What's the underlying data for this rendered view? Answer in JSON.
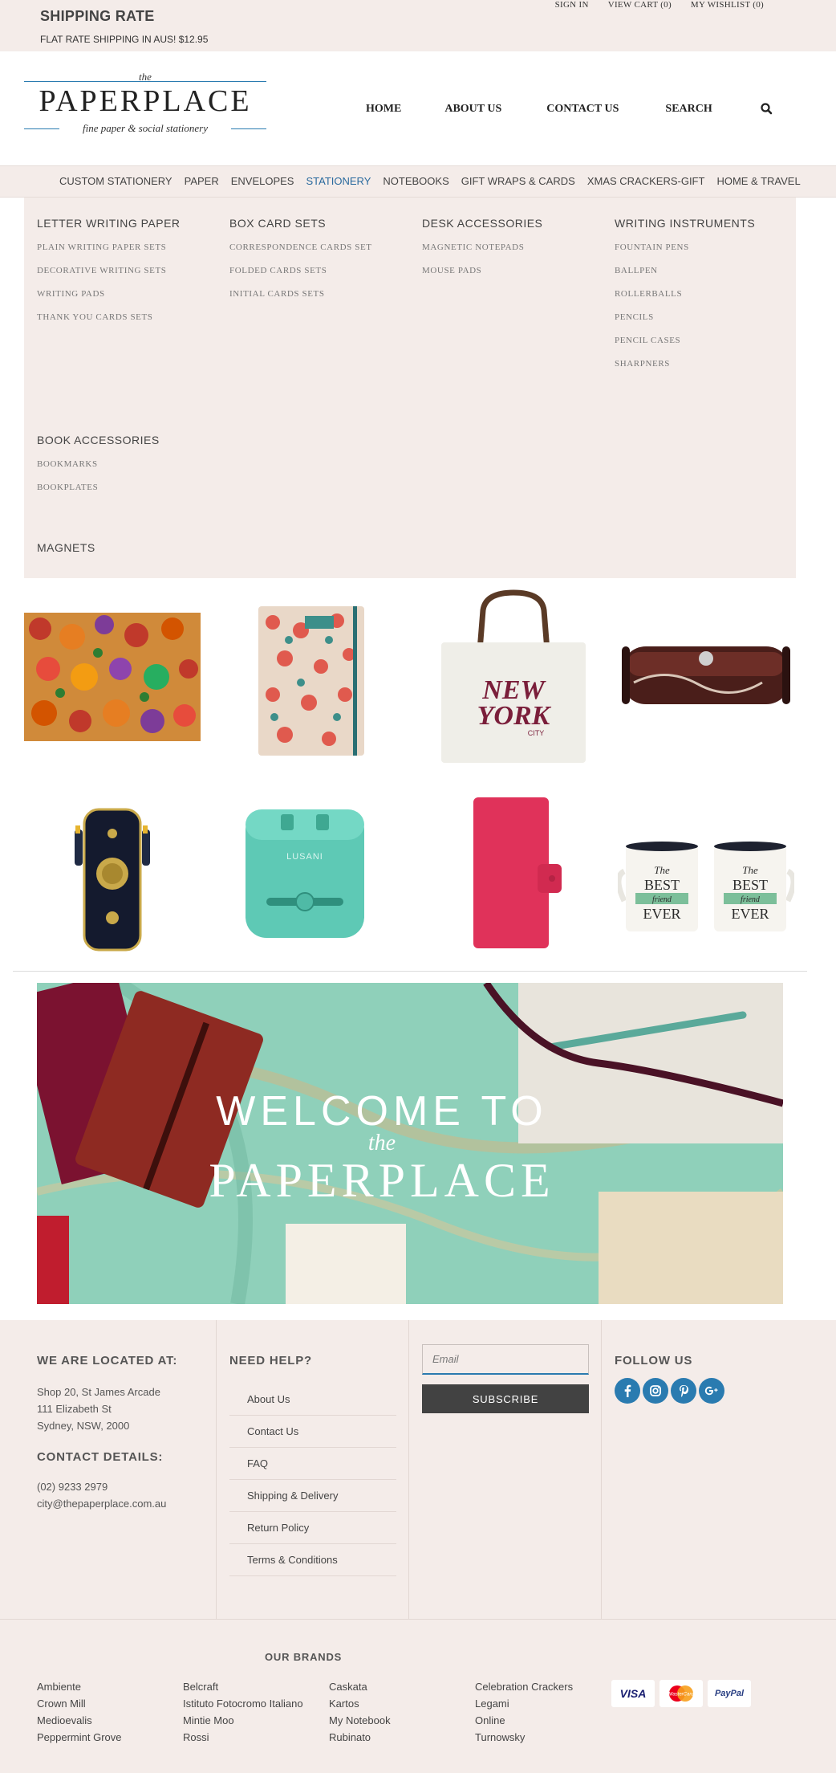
{
  "topbar": {
    "shipping_title": "SHIPPING RATE",
    "shipping_sub": "FLAT RATE SHIPPING IN AUS! $12.95",
    "links": [
      "SIGN IN",
      "VIEW CART (0)",
      "MY WISHLIST (0)"
    ]
  },
  "logo": {
    "the": "the",
    "brand": "PAPERPLACE",
    "tagline": "fine paper & social stationery"
  },
  "nav": [
    "HOME",
    "ABOUT US",
    "CONTACT US",
    "SEARCH"
  ],
  "categories": [
    "CUSTOM STATIONERY",
    "PAPER",
    "ENVELOPES",
    "STATIONERY",
    "NOTEBOOKS",
    "GIFT WRAPS & CARDS",
    "XMAS CRACKERS-GIFT",
    "HOME & TRAVEL"
  ],
  "active_category": "STATIONERY",
  "mega": {
    "letter_writing": {
      "title": "LETTER WRITING PAPER",
      "links": [
        "PLAIN WRITING PAPER SETS",
        "DECORATIVE WRITING SETS",
        "WRITING PADS",
        "THANK YOU CARDS SETS"
      ]
    },
    "box_cards": {
      "title": "BOX CARD SETS",
      "links": [
        "CORRESPONDENCE CARDS SET",
        "FOLDED CARDS SETS",
        "INITIAL CARDS SETS"
      ]
    },
    "desk": {
      "title": "DESK ACCESSORIES",
      "links": [
        "MAGNETIC NOTEPADS",
        "MOUSE PADS"
      ]
    },
    "writing_instruments": {
      "title": "WRITING INSTRUMENTS",
      "links": [
        "FOUNTAIN PENS",
        "BALLPEN",
        "ROLLERBALLS",
        "PENCILS",
        "PENCIL CASES",
        "SHARPNERS"
      ]
    },
    "book_accessories": {
      "title": "BOOK ACCESSORIES",
      "links": [
        "BOOKMARKS",
        "BOOKPLATES"
      ]
    },
    "magnets": {
      "title": "MAGNETS"
    }
  },
  "products": {
    "tote_text": [
      "NEW",
      "YORK",
      "CITY"
    ],
    "adapter_text": "LUSANI",
    "mug_text": [
      "The",
      "BEST",
      "friend",
      "EVER"
    ]
  },
  "banner": {
    "line1": "WELCOME TO",
    "line2": "the",
    "line3": "PAPERPLACE"
  },
  "footer": {
    "located_title": "WE ARE LOCATED AT:",
    "address": [
      "Shop 20, St James Arcade",
      "111 Elizabeth St",
      "Sydney, NSW, 2000"
    ],
    "contact_title": "CONTACT DETAILS:",
    "phone": "(02) 9233 2979",
    "email": "city@thepaperplace.com.au",
    "help_title": "NEED HELP?",
    "help_links": [
      "About Us",
      "Contact Us",
      "FAQ",
      "Shipping & Delivery",
      "Return Policy",
      "Terms & Conditions"
    ],
    "email_placeholder": "Email",
    "subscribe_label": "SUBSCRIBE",
    "follow_title": "FOLLOW US",
    "socials": [
      "facebook-icon",
      "instagram-icon",
      "pinterest-icon",
      "google-plus-icon"
    ]
  },
  "brands": {
    "title": "OUR BRANDS",
    "columns": [
      [
        "Ambiente",
        "Crown Mill",
        "Medioevalis",
        "Peppermint Grove"
      ],
      [
        "Belcraft",
        "Istituto Fotocromo Italiano",
        "Mintie Moo",
        "Rossi"
      ],
      [
        "Caskata",
        "Kartos",
        "My Notebook",
        "Rubinato"
      ],
      [
        "Celebration Crackers",
        "Legami",
        "Online",
        "Turnowsky"
      ]
    ],
    "payments": [
      "VISA",
      "MasterCard",
      "PayPal"
    ]
  },
  "colors": {
    "accent": "#2a7bb0",
    "background_tint": "#f4ece9",
    "active_category": "#2a6a9e",
    "subscribe": "#424242"
  }
}
